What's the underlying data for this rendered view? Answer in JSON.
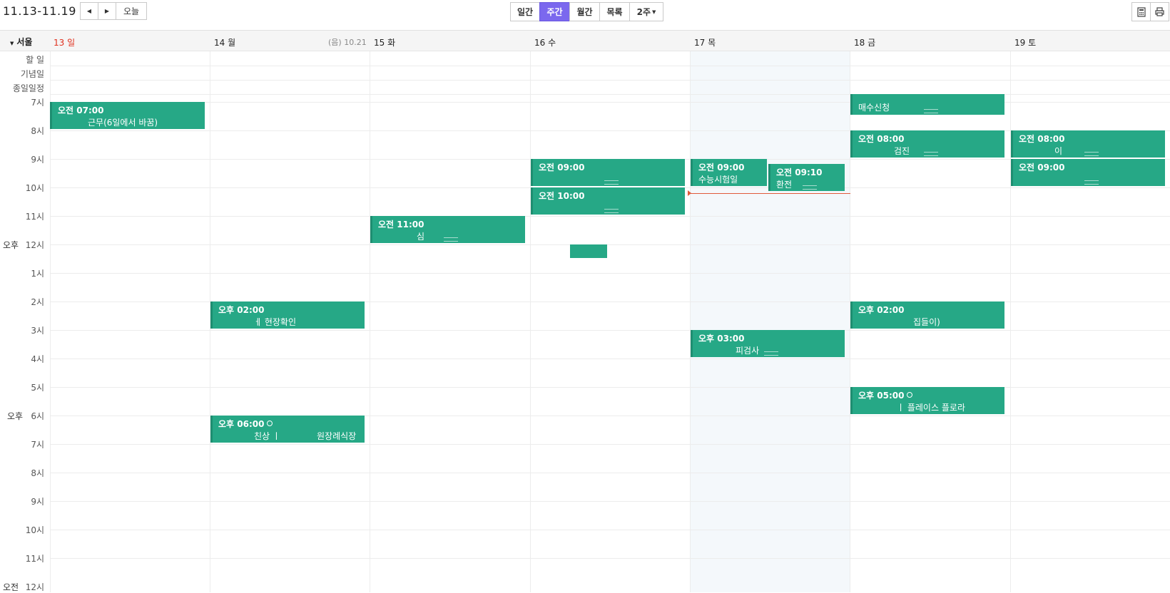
{
  "toolbar": {
    "date_range": "11.13-11.19",
    "today_label": "오늘",
    "views": [
      "일간",
      "주간",
      "월간",
      "목록",
      "2주"
    ],
    "active_view": "주간",
    "accent": "#7b68ee"
  },
  "header": {
    "timezone": "서울",
    "days": [
      "13 일",
      "14 월",
      "15 화",
      "16 수",
      "17 목",
      "18 금",
      "19 토"
    ],
    "lunar_note": "(음) 10.21"
  },
  "allday_rows": [
    "할 일",
    "기념일",
    "종일일정"
  ],
  "time_labels": [
    "7시",
    "8시",
    "9시",
    "10시",
    "11시",
    "12시",
    "1시",
    "2시",
    "3시",
    "4시",
    "5시",
    "6시",
    "7시",
    "8시",
    "9시",
    "10시",
    "11시",
    "12시"
  ],
  "ampm_labels": {
    "pm_noon": "오후",
    "pm_six": "오후",
    "am_midnight": "오전"
  },
  "events": [
    {
      "time": "오전 07:00",
      "title": "근무(6일에서 바꿈)"
    },
    {
      "time": "",
      "title": "매수신청"
    },
    {
      "time": "오전 08:00",
      "title": "검진"
    },
    {
      "time": "오전 08:00",
      "title": "이"
    },
    {
      "time": "오전 09:00",
      "title": ""
    },
    {
      "time": "오전 09:00",
      "title": "수능시험일"
    },
    {
      "time": "오전 09:10",
      "title": "환전"
    },
    {
      "time": "오전 09:00",
      "title": ""
    },
    {
      "time": "오전 10:00",
      "title": ""
    },
    {
      "time": "오전 11:00",
      "title": "심"
    },
    {
      "time": "",
      "title": ""
    },
    {
      "time": "오후 02:00",
      "title": "ㅔ 현장확인"
    },
    {
      "time": "오후 02:00",
      "title": "집들이)"
    },
    {
      "time": "오후 03:00",
      "title": "피검사"
    },
    {
      "time": "오후 05:00",
      "title": "ㅣ 플레이스 플로라"
    },
    {
      "time": "오후 06:00",
      "title": "친상 ㅣ",
      "extra": "원장례식장"
    }
  ],
  "colors": {
    "event": "#26a886",
    "today_bg": "#f4f8fb",
    "sunday": "#e0301e",
    "now_line": "#e05a3a"
  }
}
